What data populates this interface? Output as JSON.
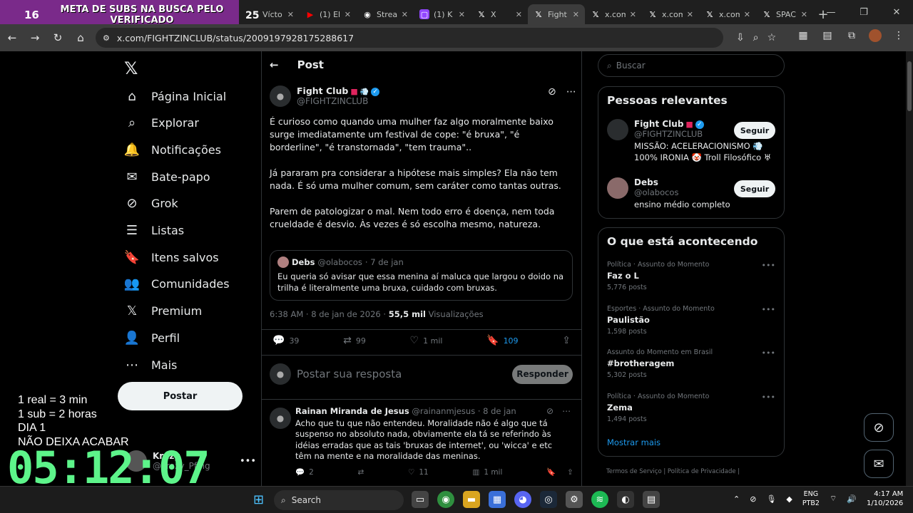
{
  "browser": {
    "tabs": [
      {
        "title": "Vícto",
        "fav": ""
      },
      {
        "title": "(1) El",
        "fav": "▶",
        "color": "#ff0000"
      },
      {
        "title": "Strea",
        "fav": "◉",
        "color": "#333"
      },
      {
        "title": "(1) K",
        "fav": "▢",
        "color": "#9146ff"
      },
      {
        "title": "X",
        "fav": "𝕏",
        "color": "#000"
      },
      {
        "title": "Fight",
        "fav": "𝕏",
        "color": "#000",
        "active": true
      },
      {
        "title": "x.com",
        "fav": "𝕏",
        "color": "#000"
      },
      {
        "title": "x.com",
        "fav": "𝕏",
        "color": "#000"
      },
      {
        "title": "x.com",
        "fav": "𝕏",
        "color": "#000"
      },
      {
        "title": "SPAC",
        "fav": "𝕏",
        "color": "#000"
      }
    ],
    "url": "x.com/FIGHTZINCLUB/status/2009197928175288617"
  },
  "stream_overlay": {
    "left_count": "16",
    "right_count": "25",
    "banner": "META DE SUBS NA BUSCA PELO VERIFICADO",
    "info_lines": [
      "1 real = 3 min",
      "1 sub = 2 horas",
      "DIA 1",
      "NÃO DEIXA ACABAR"
    ],
    "timer": "05:12:07"
  },
  "nav": {
    "items": [
      {
        "label": "Página Inicial",
        "icon": "⌂"
      },
      {
        "label": "Explorar",
        "icon": "⌕"
      },
      {
        "label": "Notificações",
        "icon": "🔔"
      },
      {
        "label": "Bate-papo",
        "icon": "✉"
      },
      {
        "label": "Grok",
        "icon": "⊘"
      },
      {
        "label": "Listas",
        "icon": "☰"
      },
      {
        "label": "Itens salvos",
        "icon": "🔖"
      },
      {
        "label": "Comunidades",
        "icon": "👥"
      },
      {
        "label": "Premium",
        "icon": "𝕏"
      },
      {
        "label": "Perfil",
        "icon": "👤"
      },
      {
        "label": "Mais",
        "icon": "⋯"
      }
    ],
    "post_button": "Postar",
    "account_name": "Krazy",
    "account_handle": "@krazy_Pfing"
  },
  "post": {
    "header": "Post",
    "author_name": "Fight Club",
    "author_handle": "@FIGHTZINCLUB",
    "paragraphs": [
      "É curioso como quando uma mulher faz algo moralmente baixo surge imediatamente um festival de cope: \"é bruxa\", \"é borderline\", \"é transtornada\", \"tem trauma\"..",
      "Já pararam pra considerar a hipótese mais simples? Ela não tem nada. É só uma mulher comum, sem caráter como tantas outras.",
      "Parem de patologizar o mal. Nem todo erro é doença, nem toda crueldade é desvio. Às vezes é só escolha mesmo, natureza."
    ],
    "quote": {
      "name": "Debs",
      "handle": "@olabocos",
      "date": "· 7 de jan",
      "text": "Eu queria só avisar que essa menina aí maluca que largou o doido na trilha é literalmente uma bruxa, cuidado com bruxas."
    },
    "timestamp": "6:38 AM · 8 de jan de 2026 · ",
    "views": "55,5 mil",
    "views_label": "Visualizações",
    "replies": "39",
    "reposts": "99",
    "likes": "1 mil",
    "bookmarks": "109",
    "reply_placeholder": "Postar sua resposta",
    "reply_button": "Responder"
  },
  "reply": {
    "name": "Rainan Miranda de Jesus",
    "handle": "@rainanmjesus · 8 de jan",
    "text": "Acho que tu que não entendeu. Moralidade não é algo que tá suspenso no absoluto nada, obviamente ela tá se referindo às idéias erradas que as tais 'bruxas de internet', ou 'wicca' e etc têm na mente e na moralidade das meninas.",
    "replies": "2",
    "likes": "11",
    "views": "1 mil"
  },
  "sidebar": {
    "search_placeholder": "Buscar",
    "relevant_title": "Pessoas relevantes",
    "people": [
      {
        "name": "Fight Club",
        "handle": "@FIGHTZINCLUB",
        "bio1": "MISSÃO: ACELERACIONISMO 💨",
        "bio2": "100% IRONIA 🤡 Troll Filosófico ♅",
        "follow": "Seguir"
      },
      {
        "name": "Debs",
        "handle": "@olabocos",
        "bio1": "ensino médio completo",
        "bio2": "",
        "follow": "Seguir"
      }
    ],
    "trends_title": "O que está acontecendo",
    "trends": [
      {
        "context": "Política · Assunto do Momento",
        "name": "Faz o L",
        "posts": "5,776 posts"
      },
      {
        "context": "Esportes · Assunto do Momento",
        "name": "Paulistão",
        "posts": "1,598 posts"
      },
      {
        "context": "Assunto do Momento em Brasil",
        "name": "#brotheragem",
        "posts": "5,302 posts"
      },
      {
        "context": "Política · Assunto do Momento",
        "name": "Zema",
        "posts": "1,494 posts"
      }
    ],
    "show_more": "Mostrar mais",
    "footer": "Termos de Serviço  |  Política de Privacidade  |"
  },
  "taskbar": {
    "search": "Search",
    "lang1": "ENG",
    "lang2": "PTB2",
    "time": "4:17 AM",
    "date": "1/10/2026"
  }
}
